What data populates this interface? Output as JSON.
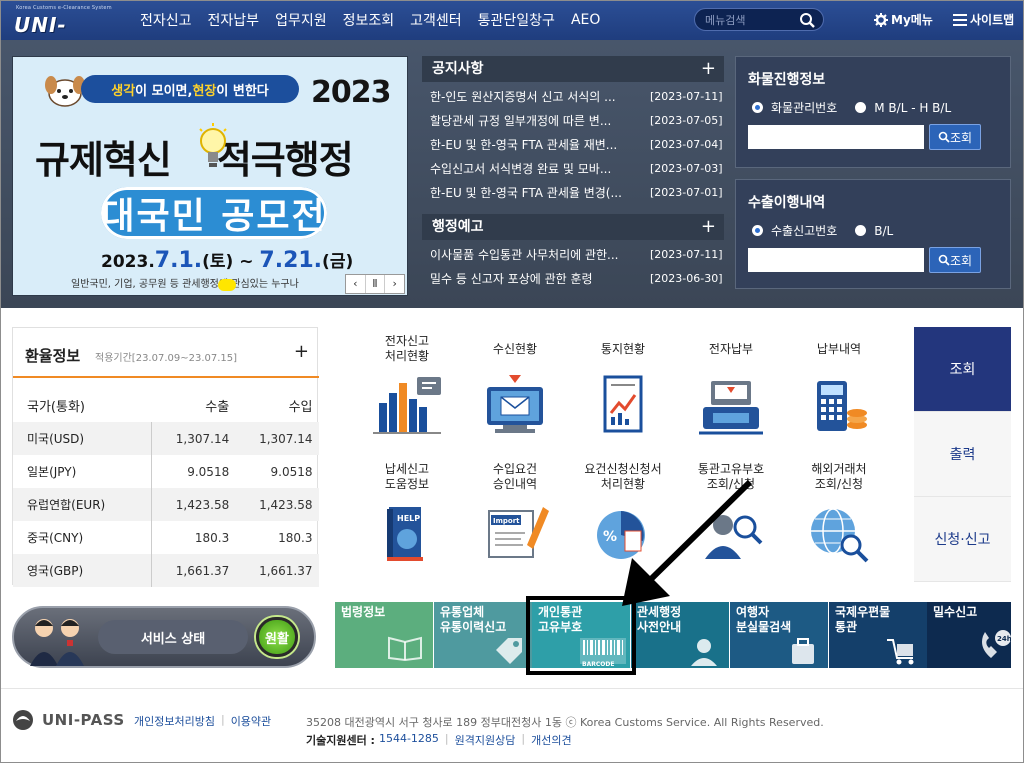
{
  "header": {
    "logo_small": "Korea Customs e-Clearance System",
    "logo_text": "UNI-PASS",
    "nav": [
      "전자신고",
      "전자납부",
      "업무지원",
      "정보조회",
      "고객센터",
      "통관단일창구",
      "AEO"
    ],
    "search_placeholder": "메뉴검색",
    "my_menu": "My메뉴",
    "sitemap": "사이트맵"
  },
  "banner": {
    "slogan_a": "생각",
    "slogan_b": "이 모이면, ",
    "slogan_c": "현장",
    "slogan_d": "이 변한다",
    "year": "2023",
    "headline_left": "규제혁신",
    "headline_right": "적극행정",
    "contest": "대국민 공모전",
    "date_prefix": "2023.",
    "date_start": "7.1.",
    "date_start_day": "(토)",
    "date_sep": " ~ ",
    "date_end": "7.21.",
    "date_end_day": "(금)",
    "sub_text": "일반국민, 기업, 공무원 등 관세행정에 관심있는 누구나",
    "controls": [
      "‹",
      "Ⅱ",
      "›"
    ]
  },
  "notice": {
    "title": "공지사항",
    "items": [
      {
        "title": "한-인도 원산지증명서 신고 서식의 ...",
        "date": "[2023-07-11]"
      },
      {
        "title": "할당관세 규정 일부개정에 따른 변...",
        "date": "[2023-07-05]"
      },
      {
        "title": "한-EU 및 한-영국 FTA 관세율 재변...",
        "date": "[2023-07-04]"
      },
      {
        "title": "수입신고서 서식변경 완료 및 모바...",
        "date": "[2023-07-03]"
      },
      {
        "title": "한-EU 및 한-영국 FTA 관세율 변경(...",
        "date": "[2023-07-01]"
      }
    ]
  },
  "admin_notice": {
    "title": "행정예고",
    "items": [
      {
        "title": "이사물품 수입통관 사무처리에 관한...",
        "date": "[2023-07-11]"
      },
      {
        "title": "밀수 등 신고자 포상에 관한 훈령",
        "date": "[2023-06-30]"
      }
    ]
  },
  "cargo": {
    "title": "화물진행정보",
    "radio1": "화물관리번호",
    "radio2": "M B/L - H B/L",
    "button": "조회"
  },
  "export": {
    "title": "수출이행내역",
    "radio1": "수출신고번호",
    "radio2": "B/L",
    "button": "조회"
  },
  "exchange": {
    "title": "환율정보",
    "period": "적용기간[23.07.09~23.07.15]",
    "columns": [
      "국가(통화)",
      "수출",
      "수입"
    ],
    "rows": [
      {
        "currency": "미국(USD)",
        "export": "1,307.14",
        "import": "1,307.14"
      },
      {
        "currency": "일본(JPY)",
        "export": "9.0518",
        "import": "9.0518"
      },
      {
        "currency": "유럽연합(EUR)",
        "export": "1,423.58",
        "import": "1,423.58"
      },
      {
        "currency": "중국(CNY)",
        "export": "180.3",
        "import": "180.3"
      },
      {
        "currency": "영국(GBP)",
        "export": "1,661.37",
        "import": "1,661.37"
      }
    ]
  },
  "services": [
    {
      "line1": "전자신고",
      "line2": "처리현황",
      "icon": "bar-chart-icon"
    },
    {
      "line1": "수신현황",
      "line2": "",
      "icon": "monitor-mail-icon"
    },
    {
      "line1": "통지현황",
      "line2": "",
      "icon": "report-document-icon"
    },
    {
      "line1": "전자납부",
      "line2": "",
      "icon": "payment-terminal-icon"
    },
    {
      "line1": "납부내역",
      "line2": "",
      "icon": "calculator-coins-icon"
    },
    {
      "line1": "납세신고",
      "line2": "도움정보",
      "icon": "help-book-icon"
    },
    {
      "line1": "수입요건",
      "line2": "승인내역",
      "icon": "import-stamp-icon"
    },
    {
      "line1": "요건신청신청서",
      "line2": "처리현황",
      "icon": "percent-chart-icon"
    },
    {
      "line1": "통관고유부호",
      "line2": "조회/신청",
      "icon": "person-search-icon"
    },
    {
      "line1": "해외거래처",
      "line2": "조회/신청",
      "icon": "globe-search-icon"
    }
  ],
  "side_tabs": [
    "조회",
    "출력",
    "신청·신고"
  ],
  "status": {
    "label": "서비스 상태",
    "value": "원활"
  },
  "tiles": [
    {
      "line1": "법령정보",
      "line2": "",
      "color": "#5cae7e",
      "icon": "book-icon"
    },
    {
      "line1": "유통업체",
      "line2": "유통이력신고",
      "color": "#4f9a9f",
      "icon": "tag-icon"
    },
    {
      "line1": "개인통관",
      "line2": "고유부호",
      "color": "#2e9fa8",
      "icon": "barcode-icon",
      "badge": "BARCODE"
    },
    {
      "line1": "관세행정",
      "line2": "사전안내",
      "color": "#19718a",
      "icon": "agent-icon"
    },
    {
      "line1": "여행자",
      "line2": "분실물검색",
      "color": "#1d5a84",
      "icon": "luggage-icon"
    },
    {
      "line1": "국제우편물",
      "line2": "통관",
      "color": "#143f6a",
      "icon": "cart-icon"
    },
    {
      "line1": "밀수신고",
      "line2": "",
      "color": "#0d2a4f",
      "icon": "phone-24-icon",
      "badge": "24h"
    }
  ],
  "footer": {
    "logo": "UNI-PASS",
    "links": [
      "개인정보처리방침",
      "이용약관"
    ],
    "address": "35208 대전광역시 서구 청사로 189 정부대전청사 1동 ⓒ Korea Customs Service. All Rights Reserved.",
    "support_label": "기술지원센터 :",
    "support_phone": "1544-1285",
    "support_links": [
      "원격지원상담",
      "개선의견"
    ]
  },
  "colors": {
    "header": "#234386",
    "top_bg": "#434f62",
    "exchange_accent": "#f08a24",
    "side_tab_active": "#23367d"
  }
}
